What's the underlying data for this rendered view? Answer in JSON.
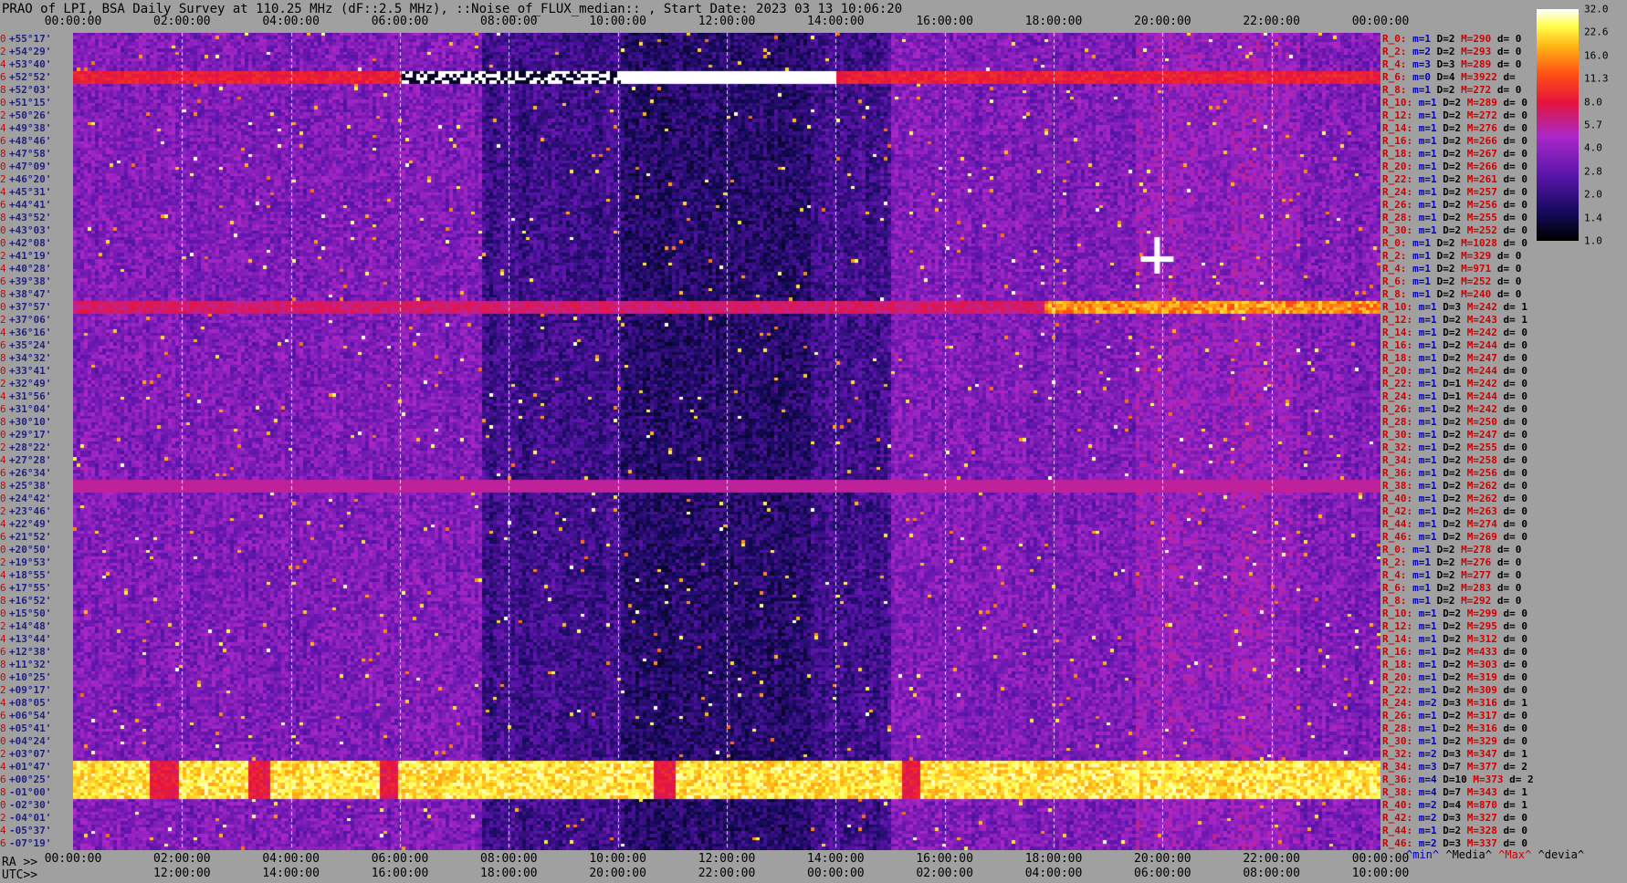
{
  "title": "PRAO of LPI, BSA Daily Survey at 110.25 MHz (dF::2.5 MHz), ::Noise_of_FLUX_median:: , Start Date: 2023 03 13 10:06:20",
  "top_ticks": [
    "00:00:00",
    "02:00:00",
    "04:00:00",
    "06:00:00",
    "08:00:00",
    "10:00:00",
    "12:00:00",
    "14:00:00",
    "16:00:00",
    "18:00:00",
    "20:00:00",
    "22:00:00",
    "00:00:00"
  ],
  "bottom_ra_label": "RA >>",
  "bottom_ra_ticks": [
    "00:00:00",
    "02:00:00",
    "04:00:00",
    "06:00:00",
    "08:00:00",
    "10:00:00",
    "12:00:00",
    "14:00:00",
    "16:00:00",
    "18:00:00",
    "20:00:00",
    "22:00:00",
    "00:00:00"
  ],
  "bottom_utc_label": "UTC>>",
  "bottom_utc_ticks": [
    "12:00:00",
    "14:00:00",
    "16:00:00",
    "18:00:00",
    "20:00:00",
    "22:00:00",
    "00:00:00",
    "02:00:00",
    "04:00:00",
    "06:00:00",
    "08:00:00",
    "10:00:00"
  ],
  "colorbar": {
    "ticks": [
      "32.0",
      "22.6",
      "16.0",
      "11.3",
      "8.0",
      "5.7",
      "4.0",
      "2.8",
      "2.0",
      "1.4",
      "1.0"
    ]
  },
  "legend": {
    "min": "^min^",
    "median": "^Media^",
    "max": "^Max^",
    "devia": "^devia^"
  },
  "chart_data": {
    "type": "heatmap",
    "title": "PRAO of LPI, BSA Daily Survey at 110.25 MHz (dF::2.5 MHz), ::Noise_of_FLUX_median:: , Start Date: 2023 03 13 10:06:20",
    "x_axis": "RA / UTC, 00:00:00 to 24:00:00",
    "color_scale": {
      "min": 1.0,
      "max": 32.0,
      "scale": "log2"
    },
    "rows": [
      {
        "idx": "0",
        "dec": "+55°17'",
        "stat": {
          "label": "R_0:",
          "m": "m=1",
          "d": "D=2",
          "M": "M=290",
          "de": "d= 0"
        }
      },
      {
        "idx": "2",
        "dec": "+54°29'",
        "stat": {
          "label": "R_2:",
          "m": "m=2",
          "d": "D=2",
          "M": "M=293",
          "de": "d= 0"
        }
      },
      {
        "idx": "4",
        "dec": "+53°40'",
        "stat": {
          "label": "R_4:",
          "m": "m=3",
          "d": "D=3",
          "M": "M=289",
          "de": "d= 0"
        }
      },
      {
        "idx": "6",
        "dec": "+52°52'",
        "stat": {
          "label": "R_6:",
          "m": "m=0",
          "d": "D=4",
          "M": "M=3922",
          "de": "d="
        }
      },
      {
        "idx": "8",
        "dec": "+52°03'",
        "stat": {
          "label": "R_8:",
          "m": "m=1",
          "d": "D=2",
          "M": "M=272",
          "de": "d= 0"
        }
      },
      {
        "idx": "10",
        "dec": "+51°15'",
        "stat": {
          "label": "R_10:",
          "m": "m=1",
          "d": "D=2",
          "M": "M=289",
          "de": "d= 0"
        }
      },
      {
        "idx": "12",
        "dec": "+50°26'",
        "stat": {
          "label": "R_12:",
          "m": "m=1",
          "d": "D=2",
          "M": "M=272",
          "de": "d= 0"
        }
      },
      {
        "idx": "14",
        "dec": "+49°38'",
        "stat": {
          "label": "R_14:",
          "m": "m=1",
          "d": "D=2",
          "M": "M=276",
          "de": "d= 0"
        }
      },
      {
        "idx": "16",
        "dec": "+48°46'",
        "stat": {
          "label": "R_16:",
          "m": "m=1",
          "d": "D=2",
          "M": "M=266",
          "de": "d= 0"
        }
      },
      {
        "idx": "18",
        "dec": "+47°58'",
        "stat": {
          "label": "R_18:",
          "m": "m=1",
          "d": "D=2",
          "M": "M=267",
          "de": "d= 0"
        }
      },
      {
        "idx": "20",
        "dec": "+47°09'",
        "stat": {
          "label": "R_20:",
          "m": "m=1",
          "d": "D=2",
          "M": "M=266",
          "de": "d= 0"
        }
      },
      {
        "idx": "22",
        "dec": "+46°20'",
        "stat": {
          "label": "R_22:",
          "m": "m=1",
          "d": "D=2",
          "M": "M=261",
          "de": "d= 0"
        }
      },
      {
        "idx": "24",
        "dec": "+45°31'",
        "stat": {
          "label": "R_24:",
          "m": "m=1",
          "d": "D=2",
          "M": "M=257",
          "de": "d= 0"
        }
      },
      {
        "idx": "26",
        "dec": "+44°41'",
        "stat": {
          "label": "R_26:",
          "m": "m=1",
          "d": "D=2",
          "M": "M=256",
          "de": "d= 0"
        }
      },
      {
        "idx": "28",
        "dec": "+43°52'",
        "stat": {
          "label": "R_28:",
          "m": "m=1",
          "d": "D=2",
          "M": "M=255",
          "de": "d= 0"
        }
      },
      {
        "idx": "30",
        "dec": "+43°03'",
        "stat": {
          "label": "R_30:",
          "m": "m=1",
          "d": "D=2",
          "M": "M=252",
          "de": "d= 0"
        }
      },
      {
        "idx": "0",
        "dec": "+42°08'",
        "stat": {
          "label": "R_0:",
          "m": "m=1",
          "d": "D=2",
          "M": "M=1028",
          "de": "d= 0"
        }
      },
      {
        "idx": "2",
        "dec": "+41°19'",
        "stat": {
          "label": "R_2:",
          "m": "m=1",
          "d": "D=2",
          "M": "M=329",
          "de": "d= 0"
        }
      },
      {
        "idx": "4",
        "dec": "+40°28'",
        "stat": {
          "label": "R_4:",
          "m": "m=1",
          "d": "D=2",
          "M": "M=971",
          "de": "d= 0"
        }
      },
      {
        "idx": "6",
        "dec": "+39°38'",
        "stat": {
          "label": "R_6:",
          "m": "m=1",
          "d": "D=2",
          "M": "M=252",
          "de": "d= 0"
        }
      },
      {
        "idx": "8",
        "dec": "+38°47'",
        "stat": {
          "label": "R_8:",
          "m": "m=1",
          "d": "D=2",
          "M": "M=240",
          "de": "d= 0"
        }
      },
      {
        "idx": "10",
        "dec": "+37°57'",
        "stat": {
          "label": "R_10:",
          "m": "m=1",
          "d": "D=3",
          "M": "M=242",
          "de": "d= 1"
        }
      },
      {
        "idx": "12",
        "dec": "+37°06'",
        "stat": {
          "label": "R_12:",
          "m": "m=1",
          "d": "D=2",
          "M": "M=243",
          "de": "d= 1"
        }
      },
      {
        "idx": "14",
        "dec": "+36°16'",
        "stat": {
          "label": "R_14:",
          "m": "m=1",
          "d": "D=2",
          "M": "M=242",
          "de": "d= 0"
        }
      },
      {
        "idx": "16",
        "dec": "+35°24'",
        "stat": {
          "label": "R_16:",
          "m": "m=1",
          "d": "D=2",
          "M": "M=244",
          "de": "d= 0"
        }
      },
      {
        "idx": "18",
        "dec": "+34°32'",
        "stat": {
          "label": "R_18:",
          "m": "m=1",
          "d": "D=2",
          "M": "M=247",
          "de": "d= 0"
        }
      },
      {
        "idx": "20",
        "dec": "+33°41'",
        "stat": {
          "label": "R_20:",
          "m": "m=1",
          "d": "D=2",
          "M": "M=244",
          "de": "d= 0"
        }
      },
      {
        "idx": "22",
        "dec": "+32°49'",
        "stat": {
          "label": "R_22:",
          "m": "m=1",
          "d": "D=1",
          "M": "M=242",
          "de": "d= 0"
        }
      },
      {
        "idx": "24",
        "dec": "+31°56'",
        "stat": {
          "label": "R_24:",
          "m": "m=1",
          "d": "D=1",
          "M": "M=244",
          "de": "d= 0"
        }
      },
      {
        "idx": "26",
        "dec": "+31°04'",
        "stat": {
          "label": "R_26:",
          "m": "m=1",
          "d": "D=2",
          "M": "M=242",
          "de": "d= 0"
        }
      },
      {
        "idx": "28",
        "dec": "+30°10'",
        "stat": {
          "label": "R_28:",
          "m": "m=1",
          "d": "D=2",
          "M": "M=250",
          "de": "d= 0"
        }
      },
      {
        "idx": "30",
        "dec": "+29°17'",
        "stat": {
          "label": "R_30:",
          "m": "m=1",
          "d": "D=2",
          "M": "M=247",
          "de": "d= 0"
        }
      },
      {
        "idx": "32",
        "dec": "+28°22'",
        "stat": {
          "label": "R_32:",
          "m": "m=1",
          "d": "D=2",
          "M": "M=255",
          "de": "d= 0"
        }
      },
      {
        "idx": "34",
        "dec": "+27°28'",
        "stat": {
          "label": "R_34:",
          "m": "m=1",
          "d": "D=2",
          "M": "M=258",
          "de": "d= 0"
        }
      },
      {
        "idx": "36",
        "dec": "+26°34'",
        "stat": {
          "label": "R_36:",
          "m": "m=1",
          "d": "D=2",
          "M": "M=256",
          "de": "d= 0"
        }
      },
      {
        "idx": "38",
        "dec": "+25°38'",
        "stat": {
          "label": "R_38:",
          "m": "m=1",
          "d": "D=2",
          "M": "M=262",
          "de": "d= 0"
        }
      },
      {
        "idx": "40",
        "dec": "+24°42'",
        "stat": {
          "label": "R_40:",
          "m": "m=1",
          "d": "D=2",
          "M": "M=262",
          "de": "d= 0"
        }
      },
      {
        "idx": "42",
        "dec": "+23°46'",
        "stat": {
          "label": "R_42:",
          "m": "m=1",
          "d": "D=2",
          "M": "M=263",
          "de": "d= 0"
        }
      },
      {
        "idx": "44",
        "dec": "+22°49'",
        "stat": {
          "label": "R_44:",
          "m": "m=1",
          "d": "D=2",
          "M": "M=274",
          "de": "d= 0"
        }
      },
      {
        "idx": "46",
        "dec": "+21°52'",
        "stat": {
          "label": "R_46:",
          "m": "m=1",
          "d": "D=2",
          "M": "M=269",
          "de": "d= 0"
        }
      },
      {
        "idx": "0",
        "dec": "+20°50'",
        "stat": {
          "label": "R_0:",
          "m": "m=1",
          "d": "D=2",
          "M": "M=278",
          "de": "d= 0"
        }
      },
      {
        "idx": "2",
        "dec": "+19°53'",
        "stat": {
          "label": "R_2:",
          "m": "m=1",
          "d": "D=2",
          "M": "M=276",
          "de": "d= 0"
        }
      },
      {
        "idx": "4",
        "dec": "+18°55'",
        "stat": {
          "label": "R_4:",
          "m": "m=1",
          "d": "D=2",
          "M": "M=277",
          "de": "d= 0"
        }
      },
      {
        "idx": "6",
        "dec": "+17°55'",
        "stat": {
          "label": "R_6:",
          "m": "m=1",
          "d": "D=2",
          "M": "M=283",
          "de": "d= 0"
        }
      },
      {
        "idx": "8",
        "dec": "+16°52'",
        "stat": {
          "label": "R_8:",
          "m": "m=1",
          "d": "D=2",
          "M": "M=292",
          "de": "d= 0"
        }
      },
      {
        "idx": "10",
        "dec": "+15°50'",
        "stat": {
          "label": "R_10:",
          "m": "m=1",
          "d": "D=2",
          "M": "M=299",
          "de": "d= 0"
        }
      },
      {
        "idx": "12",
        "dec": "+14°48'",
        "stat": {
          "label": "R_12:",
          "m": "m=1",
          "d": "D=2",
          "M": "M=295",
          "de": "d= 0"
        }
      },
      {
        "idx": "14",
        "dec": "+13°44'",
        "stat": {
          "label": "R_14:",
          "m": "m=1",
          "d": "D=2",
          "M": "M=312",
          "de": "d= 0"
        }
      },
      {
        "idx": "16",
        "dec": "+12°38'",
        "stat": {
          "label": "R_16:",
          "m": "m=1",
          "d": "D=2",
          "M": "M=433",
          "de": "d= 0"
        }
      },
      {
        "idx": "18",
        "dec": "+11°32'",
        "stat": {
          "label": "R_18:",
          "m": "m=1",
          "d": "D=2",
          "M": "M=303",
          "de": "d= 0"
        }
      },
      {
        "idx": "20",
        "dec": "+10°25'",
        "stat": {
          "label": "R_20:",
          "m": "m=1",
          "d": "D=2",
          "M": "M=319",
          "de": "d= 0"
        }
      },
      {
        "idx": "22",
        "dec": "+09°17'",
        "stat": {
          "label": "R_22:",
          "m": "m=1",
          "d": "D=2",
          "M": "M=309",
          "de": "d= 0"
        }
      },
      {
        "idx": "24",
        "dec": "+08°05'",
        "stat": {
          "label": "R_24:",
          "m": "m=2",
          "d": "D=3",
          "M": "M=316",
          "de": "d= 1"
        }
      },
      {
        "idx": "26",
        "dec": "+06°54'",
        "stat": {
          "label": "R_26:",
          "m": "m=1",
          "d": "D=2",
          "M": "M=317",
          "de": "d= 0"
        }
      },
      {
        "idx": "28",
        "dec": "+05°41'",
        "stat": {
          "label": "R_28:",
          "m": "m=1",
          "d": "D=2",
          "M": "M=316",
          "de": "d= 0"
        }
      },
      {
        "idx": "30",
        "dec": "+04°24'",
        "stat": {
          "label": "R_30:",
          "m": "m=1",
          "d": "D=2",
          "M": "M=329",
          "de": "d= 0"
        }
      },
      {
        "idx": "32",
        "dec": "+03°07'",
        "stat": {
          "label": "R_32:",
          "m": "m=2",
          "d": "D=3",
          "M": "M=347",
          "de": "d= 1"
        }
      },
      {
        "idx": "34",
        "dec": "+01°47'",
        "stat": {
          "label": "R_34:",
          "m": "m=3",
          "d": "D=7",
          "M": "M=377",
          "de": "d= 2"
        }
      },
      {
        "idx": "36",
        "dec": "+00°25'",
        "stat": {
          "label": "R_36:",
          "m": "m=4",
          "d": "D=10",
          "M": "M=373",
          "de": "d= 2"
        }
      },
      {
        "idx": "38",
        "dec": "-01°00'",
        "stat": {
          "label": "R_38:",
          "m": "m=4",
          "d": "D=7",
          "M": "M=343",
          "de": "d= 1"
        }
      },
      {
        "idx": "40",
        "dec": "-02°30'",
        "stat": {
          "label": "R_40:",
          "m": "m=2",
          "d": "D=4",
          "M": "M=870",
          "de": "d= 1"
        }
      },
      {
        "idx": "42",
        "dec": "-04°01'",
        "stat": {
          "label": "R_42:",
          "m": "m=2",
          "d": "D=3",
          "M": "M=327",
          "de": "d= 0"
        }
      },
      {
        "idx": "44",
        "dec": "-05°37'",
        "stat": {
          "label": "R_44:",
          "m": "m=1",
          "d": "D=2",
          "M": "M=328",
          "de": "d= 0"
        }
      },
      {
        "idx": "46",
        "dec": "-07°19'",
        "stat": {
          "label": "R_46:",
          "m": "m=2",
          "d": "D=3",
          "M": "M=337",
          "de": "d= 0"
        }
      }
    ]
  }
}
